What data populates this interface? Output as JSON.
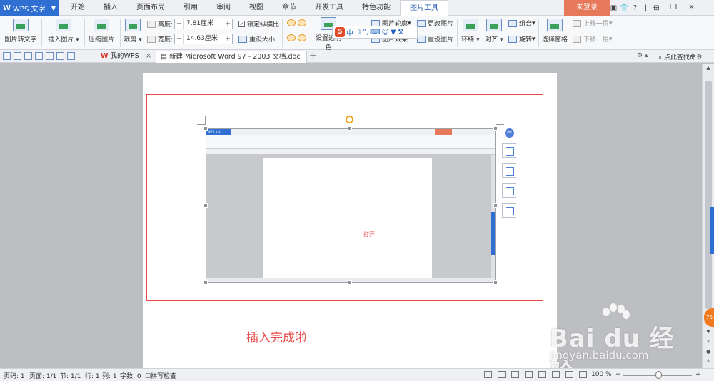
{
  "app": {
    "name": "WPS 文字"
  },
  "menu_tabs": [
    "开始",
    "插入",
    "页面布局",
    "引用",
    "审阅",
    "视图",
    "章节",
    "开发工具",
    "特色功能",
    "图片工具"
  ],
  "login_label": "未登录",
  "window_icons": [
    "▣",
    "👕",
    "?",
    "|",
    "⊡"
  ],
  "window_controls": [
    "—",
    "❐",
    "✕"
  ],
  "ribbon": {
    "pic_to_text": "图片转文字",
    "insert_pic": "插入图片",
    "compress_pic": "压缩图片",
    "crop": "裁剪",
    "height_label": "高度:",
    "height_value": "7.81厘米",
    "width_label": "宽度:",
    "width_value": "14.63厘米",
    "lock_ratio": "锁定纵横比",
    "reset_size": "重设大小",
    "set_transparent": "设置透明色",
    "picture_outline": "图片轮廓",
    "picture_effect": "图片效果",
    "change_picture": "更改图片",
    "reset_picture": "重设图片",
    "wrap": "环绕",
    "align": "对齐",
    "group": "组合",
    "rotate": "旋转",
    "select_pane": "选择窗格",
    "bring_forward": "上移一层",
    "send_backward": "下移一层"
  },
  "ime": {
    "mode": "中"
  },
  "tabs": {
    "home": "我的WPS",
    "current_doc": "新建 Microsoft Word 97 - 2003 文档.doc *",
    "find_command": "点此查找命令"
  },
  "document": {
    "inner_open_text": "打开",
    "body_text": "插入完成啦"
  },
  "status_bar": {
    "page_num": "页码: 1",
    "pages": "页面: 1/1",
    "section": "节: 1/1",
    "row": "行: 1",
    "col": "列: 1",
    "words": "字数: 0",
    "spell_check": "拼写检查",
    "zoom": "100 %"
  },
  "watermark": {
    "brand": "Bai du 经验",
    "url": "jingyan.baidu.com"
  },
  "side_bubble": "76"
}
